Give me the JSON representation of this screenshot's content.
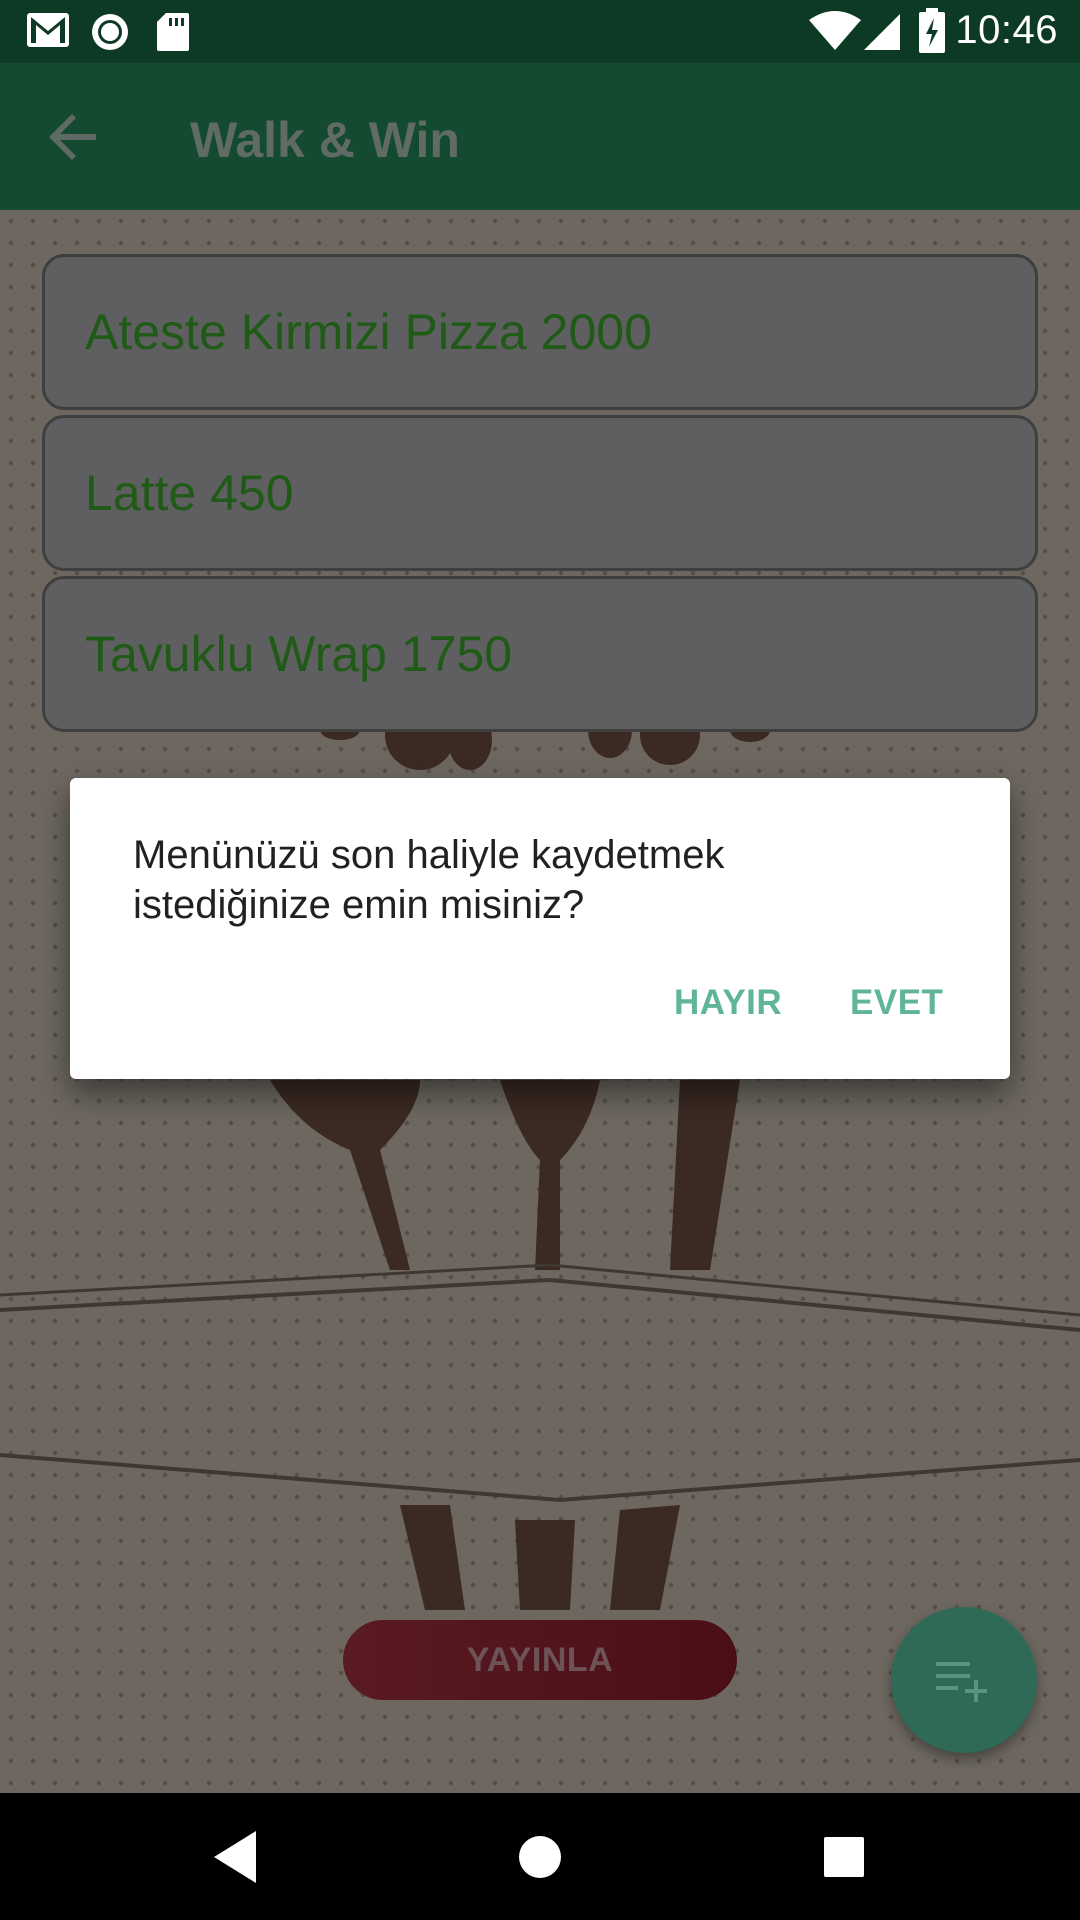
{
  "status_bar": {
    "time": "10:46",
    "icons": [
      "gmail-icon",
      "record-icon",
      "sd-card-icon",
      "wifi-icon",
      "signal-icon",
      "battery-charging-icon"
    ]
  },
  "app_bar": {
    "title": "Walk & Win",
    "back_icon": "arrow-back-icon"
  },
  "menu_items": [
    {
      "label": "Ateste Kirmizi Pizza 2000"
    },
    {
      "label": "Latte 450"
    },
    {
      "label": "Tavuklu Wrap 1750"
    }
  ],
  "dialog": {
    "message": "Menünüzü son haliyle kaydetmek istediğinize emin misiniz?",
    "negative_label": "HAYIR",
    "positive_label": "EVET"
  },
  "publish_button": {
    "label": "YAYINLA"
  },
  "fab": {
    "icon": "playlist-add-icon"
  },
  "nav_bar": {
    "icons": [
      "back-triangle-icon",
      "home-circle-icon",
      "recents-square-icon"
    ]
  },
  "colors": {
    "app_bar": "#134a30",
    "status_bar": "#0d3a24",
    "item_text": "#1f5a16",
    "dialog_button": "#5fb596",
    "publish_button": "#5a1a22",
    "fab": "#2e6a55"
  }
}
